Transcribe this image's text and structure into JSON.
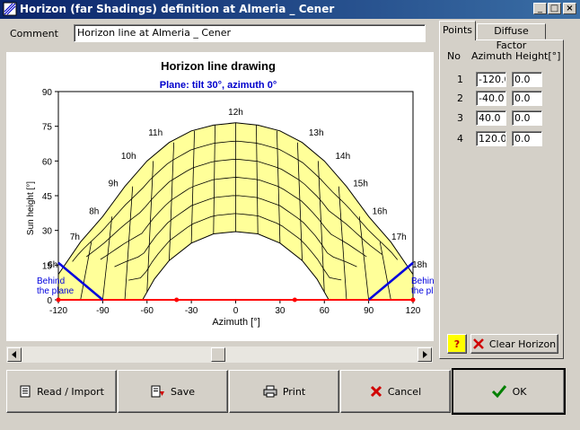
{
  "window": {
    "title": "Horizon (far Shadings) definition at Almeria _ Cener",
    "minimize": "_",
    "maximize": "□",
    "close": "×"
  },
  "comment": {
    "label": "Comment",
    "value": "Horizon line at Almeria _ Cener"
  },
  "tabs": [
    {
      "label": "Points"
    },
    {
      "label": "Diffuse Factor"
    }
  ],
  "points_table": {
    "headers": {
      "no": "No",
      "azimuth": "Azimuth",
      "height": "Height[°]"
    },
    "rows": [
      {
        "no": "1",
        "azimuth": "-120.0",
        "height": "0.0"
      },
      {
        "no": "2",
        "azimuth": "-40.0",
        "height": "0.0"
      },
      {
        "no": "3",
        "azimuth": "40.0",
        "height": "0.0"
      },
      {
        "no": "4",
        "azimuth": "120.0",
        "height": "0.0"
      }
    ]
  },
  "help_button": {
    "label": "?"
  },
  "clear_horizon_button": {
    "label": "Clear Horizon"
  },
  "buttons": {
    "read_import": "Read / Import",
    "save": "Save",
    "print": "Print",
    "cancel": "Cancel",
    "ok": "OK"
  },
  "chart_data": {
    "type": "line",
    "title": "Horizon line drawing",
    "subtitle": "Plane: tilt 30°, azimuth 0°",
    "xlabel": "Azimuth [°]",
    "ylabel": "Sun height [°]",
    "xlim": [
      -120,
      120
    ],
    "ylim": [
      0,
      90
    ],
    "xticks": [
      "-120",
      "-90",
      "-60",
      "-30",
      "0",
      "30",
      "60",
      "90",
      "120"
    ],
    "yticks": [
      "0",
      "15",
      "30",
      "45",
      "60",
      "75",
      "90"
    ],
    "hour_labels": [
      "6h",
      "7h",
      "8h",
      "9h",
      "10h",
      "11h",
      "12h",
      "13h",
      "14h",
      "15h",
      "16h",
      "17h",
      "18h"
    ],
    "behind_plane_label": [
      "Behind",
      "the plane"
    ],
    "sun_path_outer": {
      "x": [
        -120,
        -105,
        -90,
        -75,
        -60,
        -45,
        -30,
        -15,
        0,
        15,
        30,
        45,
        60,
        75,
        90,
        105,
        120
      ],
      "y": [
        11,
        25,
        36,
        49,
        60,
        68,
        73,
        75.5,
        76.5,
        75.5,
        73,
        68,
        60,
        49,
        36,
        25,
        11
      ]
    },
    "sun_path_inner": {
      "x": [
        -63,
        -55,
        -45,
        -30,
        -15,
        0,
        15,
        30,
        45,
        55,
        63
      ],
      "y": [
        0,
        9,
        17,
        24.5,
        28.5,
        29.5,
        28.5,
        24.5,
        17,
        9,
        0
      ]
    },
    "series": [
      {
        "name": "Horizon",
        "color": "#ff0000",
        "x": [
          -120,
          -40,
          40,
          120
        ],
        "y": [
          0,
          0,
          0,
          0
        ]
      },
      {
        "name": "Plane limit left",
        "color": "#0000dd",
        "x": [
          -120,
          -90
        ],
        "y": [
          16,
          0
        ]
      },
      {
        "name": "Plane limit right",
        "color": "#0000dd",
        "x": [
          90,
          120
        ],
        "y": [
          0,
          16
        ]
      }
    ],
    "grid": true,
    "colors": {
      "fill": "#ffff99",
      "horizon": "#ff0000",
      "plane": "#0000dd",
      "grid": "#000000"
    }
  }
}
